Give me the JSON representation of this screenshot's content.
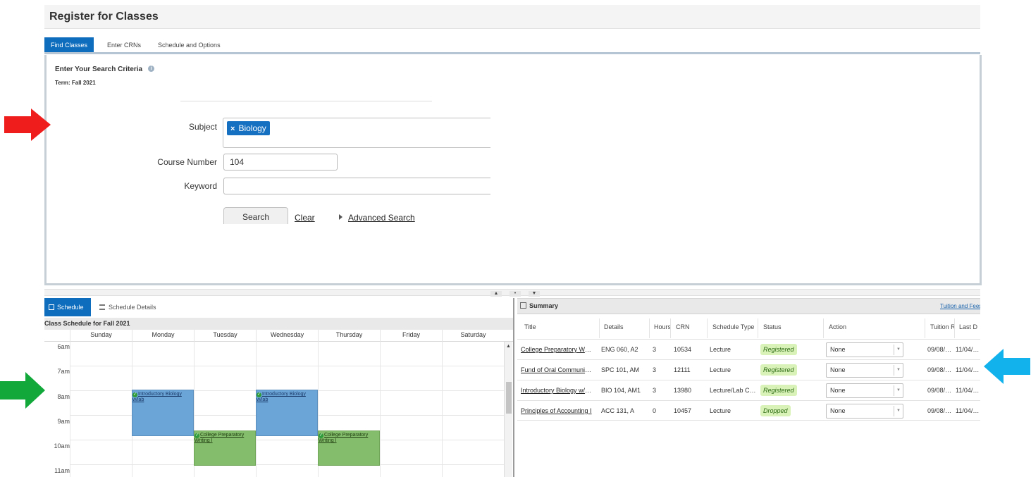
{
  "header": {
    "title": "Register for Classes"
  },
  "tabs": [
    {
      "label": "Find Classes",
      "active": true
    },
    {
      "label": "Enter CRNs",
      "active": false
    },
    {
      "label": "Schedule and Options",
      "active": false
    }
  ],
  "search": {
    "heading": "Enter Your Search Criteria",
    "term": "Term: Fall 2021",
    "subject_label": "Subject",
    "subject_chip": "Biology",
    "course_number_label": "Course Number",
    "course_number_value": "104",
    "keyword_label": "Keyword",
    "keyword_value": "",
    "search_button": "Search",
    "clear_link": "Clear",
    "advanced_link": "Advanced Search"
  },
  "splitter": {
    "up": "▲",
    "mid": "•",
    "down": "▼"
  },
  "schedule": {
    "tab_schedule": "Schedule",
    "tab_details": "Schedule Details",
    "caption": "Class Schedule for Fall 2021",
    "days": [
      "Sunday",
      "Monday",
      "Tuesday",
      "Wednesday",
      "Thursday",
      "Friday",
      "Saturday"
    ],
    "times": [
      "6am",
      "7am",
      "8am",
      "9am",
      "10am",
      "11am"
    ],
    "events": [
      {
        "title": "Introductory Biology w/lab",
        "day": "Monday",
        "start": 8,
        "end": 10,
        "kind": "bio"
      },
      {
        "title": "Introductory Biology w/lab",
        "day": "Wednesday",
        "start": 8,
        "end": 10,
        "kind": "bio"
      },
      {
        "title": "College Preparatory Writing I",
        "day": "Tuesday",
        "start": 9.5,
        "end": 11,
        "kind": "wri"
      },
      {
        "title": "College Preparatory Writing I",
        "day": "Thursday",
        "start": 9.5,
        "end": 11,
        "kind": "wri"
      }
    ]
  },
  "summary": {
    "title": "Summary",
    "tuition_link": "Tuition and Fees",
    "columns": [
      "Title",
      "Details",
      "Hours",
      "CRN",
      "Schedule Type",
      "Status",
      "Action",
      "Tuition R",
      "Last D"
    ],
    "rows": [
      {
        "title": "College Preparatory Writi…",
        "details": "ENG 060, A2",
        "hours": "3",
        "crn": "10534",
        "type": "Lecture",
        "status": "Registered",
        "action": "None",
        "tuition": "09/08/…",
        "last": "11/04/…"
      },
      {
        "title": "Fund of Oral Communicat…",
        "details": "SPC 101, AM",
        "hours": "3",
        "crn": "12111",
        "type": "Lecture",
        "status": "Registered",
        "action": "None",
        "tuition": "09/08/…",
        "last": "11/04/…"
      },
      {
        "title": "Introductory Biology w/lab",
        "details": "BIO 104, AM1",
        "hours": "3",
        "crn": "13980",
        "type": "Lecture/Lab C…",
        "status": "Registered",
        "action": "None",
        "tuition": "09/08/…",
        "last": "11/04/…"
      },
      {
        "title": "Principles of Accounting I",
        "details": "ACC 131, A",
        "hours": "0",
        "crn": "10457",
        "type": "Lecture",
        "status": "Dropped",
        "action": "None",
        "tuition": "09/08/…",
        "last": "11/04/…"
      }
    ]
  },
  "colors": {
    "accent": "#0f6dbd",
    "red_arrow": "#f01d1d",
    "green_arrow": "#12a83a",
    "blue_arrow": "#12b2ec",
    "bio_event": "#6ba4d6",
    "writing_event": "#84bd6b",
    "status_badge": "#d9f2b8"
  }
}
